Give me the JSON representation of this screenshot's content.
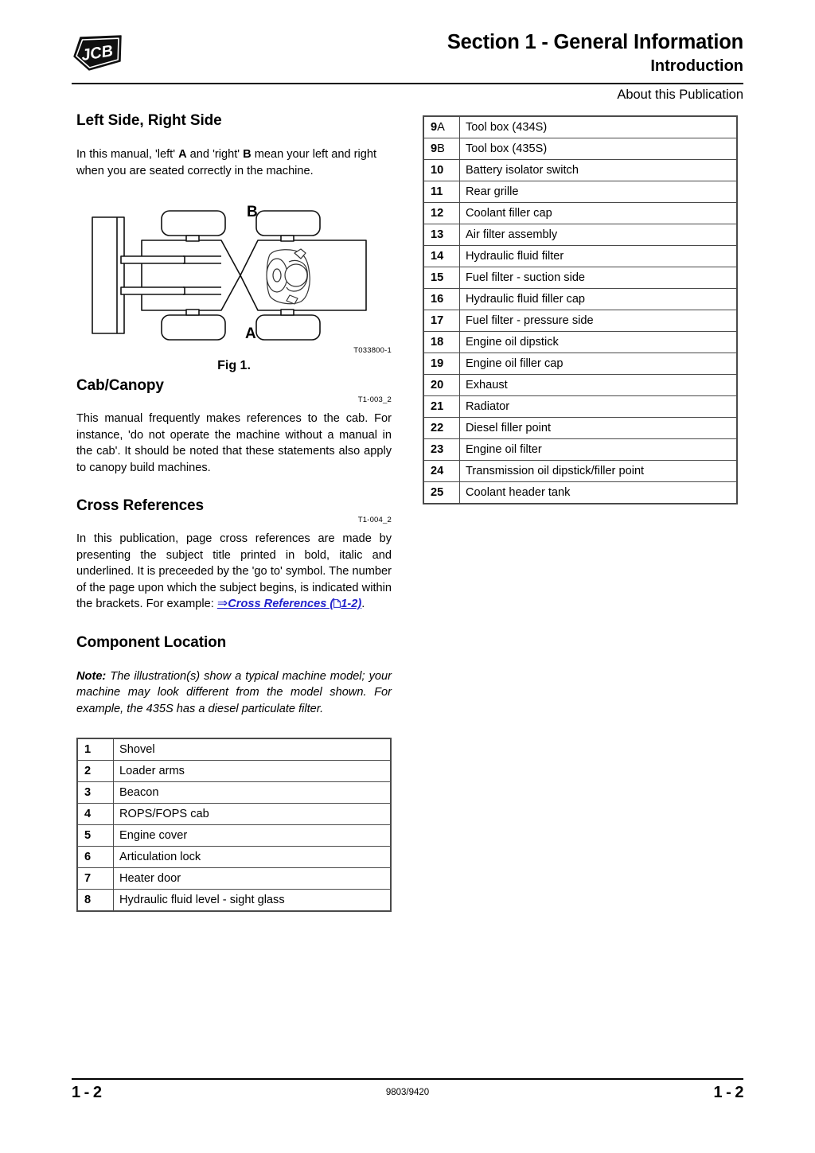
{
  "header": {
    "logo_text": "JCB",
    "title": "Section 1 - General Information",
    "subtitle": "Introduction",
    "subject": "About this Publication"
  },
  "left_column": {
    "section_left_right": {
      "heading": "Left Side, Right Side",
      "paragraph_pre": "In this manual, 'left' ",
      "paragraph_a": "A",
      "paragraph_mid": " and 'right' ",
      "paragraph_b": "B",
      "paragraph_post": " mean your left and right when you are seated correctly in the machine."
    },
    "figure": {
      "label_a": "A",
      "label_b": "B",
      "code": "T033800-1",
      "caption": "Fig 1."
    },
    "section_cab": {
      "heading": "Cab/Canopy",
      "refcode": "T1-003_2",
      "paragraph": "This manual frequently makes references to the cab. For instance, 'do not operate the machine without a manual in the cab'. It should be noted that these statements also apply to canopy build machines."
    },
    "section_cross_refs": {
      "heading": "Cross References",
      "refcode": "T1-004_2",
      "paragraph_pre": "In this publication, page cross references are made by presenting the subject title printed in bold, italic and underlined. It is preceeded by the 'go to' symbol. The number of the page upon which the subject begins, is indicated within the brackets. For example: ",
      "goto_symbol": "⇒",
      "link_text_1": "Cross References (",
      "link_page": "1-2)",
      "paragraph_post": "."
    },
    "section_component_location": {
      "heading": "Component Location",
      "note_label": "Note:",
      "note_text": " The illustration(s) show a typical machine model; your machine may look different from the model shown. For example, the 435S has a diesel particulate filter."
    },
    "parts_table": {
      "rows": [
        {
          "num": "1",
          "suffix": "",
          "desc": "Shovel"
        },
        {
          "num": "2",
          "suffix": "",
          "desc": "Loader arms"
        },
        {
          "num": "3",
          "suffix": "",
          "desc": "Beacon"
        },
        {
          "num": "4",
          "suffix": "",
          "desc": "ROPS/FOPS cab"
        },
        {
          "num": "5",
          "suffix": "",
          "desc": "Engine cover"
        },
        {
          "num": "6",
          "suffix": "",
          "desc": "Articulation lock"
        },
        {
          "num": "7",
          "suffix": "",
          "desc": "Heater door"
        },
        {
          "num": "8",
          "suffix": "",
          "desc": "Hydraulic fluid level - sight glass"
        }
      ]
    }
  },
  "right_column": {
    "parts_table": {
      "rows": [
        {
          "num": "9",
          "suffix": "A",
          "desc": "Tool box (434S)"
        },
        {
          "num": "9",
          "suffix": "B",
          "desc": "Tool box (435S)"
        },
        {
          "num": "10",
          "suffix": "",
          "desc": "Battery isolator switch"
        },
        {
          "num": "11",
          "suffix": "",
          "desc": "Rear grille"
        },
        {
          "num": "12",
          "suffix": "",
          "desc": "Coolant filler cap"
        },
        {
          "num": "13",
          "suffix": "",
          "desc": "Air filter assembly"
        },
        {
          "num": "14",
          "suffix": "",
          "desc": "Hydraulic fluid filter"
        },
        {
          "num": "15",
          "suffix": "",
          "desc": "Fuel filter - suction side"
        },
        {
          "num": "16",
          "suffix": "",
          "desc": "Hydraulic fluid filler cap"
        },
        {
          "num": "17",
          "suffix": "",
          "desc": "Fuel filter - pressure side"
        },
        {
          "num": "18",
          "suffix": "",
          "desc": "Engine oil dipstick"
        },
        {
          "num": "19",
          "suffix": "",
          "desc": "Engine oil filler cap"
        },
        {
          "num": "20",
          "suffix": "",
          "desc": "Exhaust"
        },
        {
          "num": "21",
          "suffix": "",
          "desc": "Radiator"
        },
        {
          "num": "22",
          "suffix": "",
          "desc": "Diesel filler point"
        },
        {
          "num": "23",
          "suffix": "",
          "desc": "Engine oil filter"
        },
        {
          "num": "24",
          "suffix": "",
          "desc": "Transmission oil dipstick/filler point"
        },
        {
          "num": "25",
          "suffix": "",
          "desc": "Coolant header tank"
        }
      ]
    }
  },
  "footer": {
    "page_left": "1 - 2",
    "publication_number": "9803/9420",
    "page_right": "1 - 2"
  },
  "colors": {
    "link": "#2222cc",
    "rule": "#000000",
    "table_border": "#4a4a4a"
  }
}
